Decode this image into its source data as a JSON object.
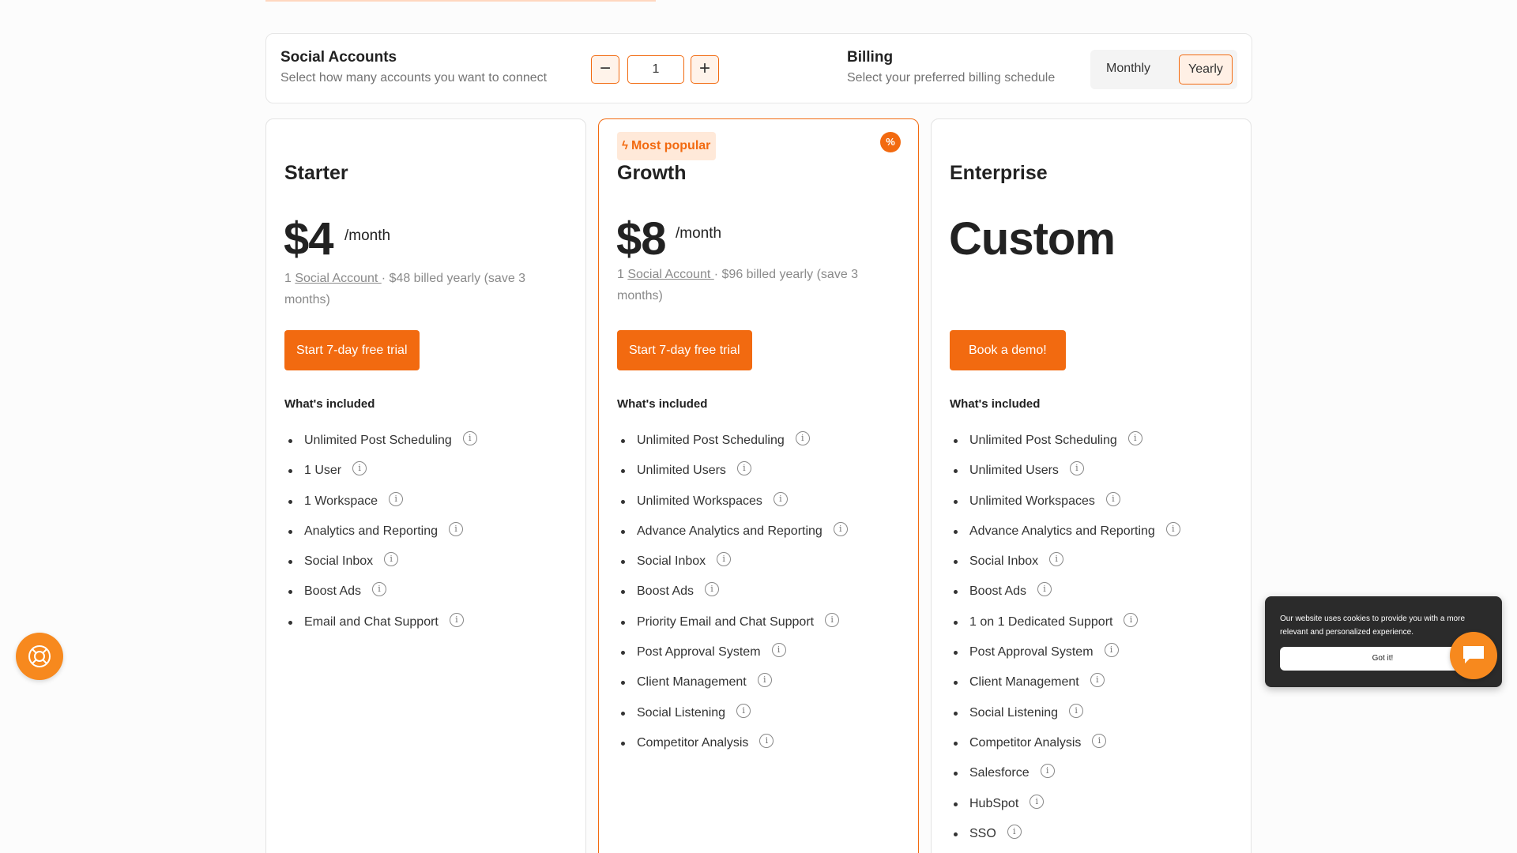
{
  "config": {
    "accounts_title": "Social Accounts",
    "accounts_sub": "Select how many accounts you want to connect",
    "decrement_label": "−",
    "increment_label": "+",
    "accounts_value": "1",
    "billing_title": "Billing",
    "billing_sub": "Select your preferred billing schedule",
    "monthly_label": "Monthly",
    "yearly_label": "Yearly",
    "selected_billing": "Yearly"
  },
  "plans": [
    {
      "name": "Starter",
      "price": "$4",
      "unit": "/month",
      "note_prefix": "1 ",
      "note_link": "Social Account ",
      "note_suffix": "· $48 billed yearly (save 3 months)",
      "cta": "Start 7-day free trial",
      "included_label": "What's included",
      "features": [
        "Unlimited Post Scheduling",
        "1 User",
        "1 Workspace",
        "Analytics and Reporting",
        "Social Inbox",
        "Boost Ads",
        "Email and Chat Support"
      ]
    },
    {
      "name": "Growth",
      "badge": "Most popular",
      "price": "$8",
      "unit": "/month",
      "note_prefix": "1 ",
      "note_link": "Social Account ",
      "note_suffix": "· $96 billed yearly (save 3 months)",
      "cta": "Start 7-day free trial",
      "included_label": "What's included",
      "features": [
        "Unlimited Post Scheduling",
        "Unlimited Users",
        "Unlimited Workspaces",
        "Advance Analytics and Reporting",
        "Social Inbox",
        "Boost Ads",
        "Priority Email and Chat Support",
        "Post Approval System",
        "Client Management",
        "Social Listening",
        "Competitor Analysis"
      ]
    },
    {
      "name": "Enterprise",
      "price": "Custom",
      "cta": "Book a demo!",
      "included_label": "What's included",
      "features": [
        "Unlimited Post Scheduling",
        "Unlimited Users",
        "Unlimited Workspaces",
        "Advance Analytics and Reporting",
        "Social Inbox",
        "Boost Ads",
        "1 on 1 Dedicated Support",
        "Post Approval System",
        "Client Management",
        "Social Listening",
        "Competitor Analysis",
        "Salesforce",
        "HubSpot",
        "SSO"
      ]
    }
  ],
  "cookie": {
    "text": "Our website uses cookies to provide you with a more relevant and personalized experience.",
    "button": "Got it!"
  },
  "icons": {
    "info": "info-icon",
    "help": "lifebuoy-icon",
    "chat": "chat-bubble-icon",
    "badge": "lightning-icon",
    "discount": "percent-icon"
  },
  "colors": {
    "accent": "#f26a10",
    "fab": "#f7891e",
    "cookie_bg": "#2b2b2b"
  }
}
